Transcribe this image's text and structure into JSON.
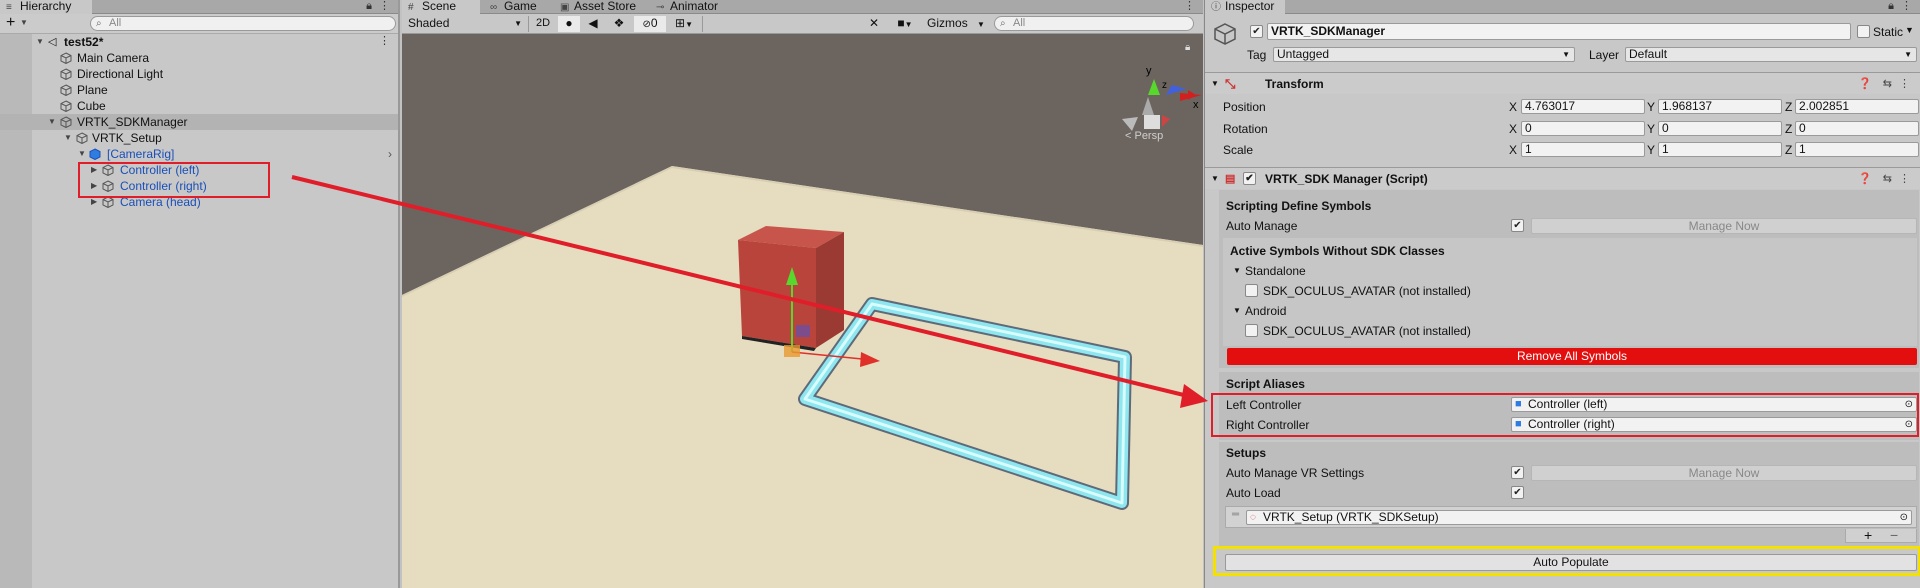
{
  "hierarchy": {
    "tab_label": "Hierarchy",
    "add_label": "+",
    "search_placeholder": "All",
    "items": [
      {
        "label": "test52*"
      },
      {
        "label": "Main Camera"
      },
      {
        "label": "Directional Light"
      },
      {
        "label": "Plane"
      },
      {
        "label": "Cube"
      },
      {
        "label": "VRTK_SDKManager"
      },
      {
        "label": "VRTK_Setup"
      },
      {
        "label": "[CameraRig]"
      },
      {
        "label": "Controller (left)"
      },
      {
        "label": "Controller (right)"
      },
      {
        "label": "Camera (head)"
      }
    ]
  },
  "scene": {
    "tabs": [
      {
        "label": "Scene"
      },
      {
        "label": "Game"
      },
      {
        "label": "Asset Store"
      },
      {
        "label": "Animator"
      }
    ],
    "shading_mode": "Shaded",
    "mode_2d": "2D",
    "hidden_count": "0",
    "gizmos_label": "Gizmos",
    "search_placeholder": "All",
    "persp_label": "< Persp",
    "axis_x": "x",
    "axis_y": "y",
    "axis_z": "z"
  },
  "inspector": {
    "tab_label": "Inspector",
    "object_name": "VRTK_SDKManager",
    "static_label": "Static",
    "tag_label": "Tag",
    "tag_value": "Untagged",
    "layer_label": "Layer",
    "layer_value": "Default",
    "transform": {
      "title": "Transform",
      "position_label": "Position",
      "rotation_label": "Rotation",
      "scale_label": "Scale",
      "axis_x": "X",
      "axis_y": "Y",
      "axis_z": "Z",
      "position": [
        "4.763017",
        "1.968137",
        "2.002851"
      ],
      "rotation": [
        "0",
        "0",
        "0"
      ],
      "scale": [
        "1",
        "1",
        "1"
      ]
    },
    "script": {
      "title": "VRTK_SDK Manager (Script)",
      "sds_heading": "Scripting Define Symbols",
      "auto_manage_label": "Auto Manage",
      "manage_now_label": "Manage Now",
      "active_symbols_heading": "Active Symbols Without SDK Classes",
      "standalone_label": "Standalone",
      "standalone_symbol": "SDK_OCULUS_AVATAR (not installed)",
      "android_label": "Android",
      "android_symbol": "SDK_OCULUS_AVATAR (not installed)",
      "remove_all_label": "Remove All Symbols",
      "aliases_heading": "Script Aliases",
      "left_controller_label": "Left Controller",
      "left_controller_value": "Controller (left)",
      "right_controller_label": "Right Controller",
      "right_controller_value": "Controller (right)",
      "setups_heading": "Setups",
      "auto_manage_vr_label": "Auto Manage VR Settings",
      "manage_now2_label": "Manage Now",
      "auto_load_label": "Auto Load",
      "setup_item": "VRTK_Setup (VRTK_SDKSetup)",
      "plus_label": "+",
      "minus_label": "−",
      "auto_populate_label": "Auto Populate"
    }
  },
  "colors": {
    "remove_button": "#e30e0e",
    "annotation_red": "#e01e2a",
    "annotation_yellow": "#f5e100",
    "floor": "#e6dcc0",
    "cube": "#b8443b",
    "frame": "#8ee6ee"
  }
}
